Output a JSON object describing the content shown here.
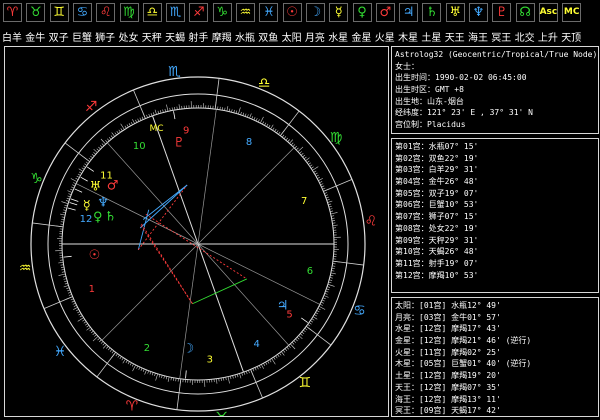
{
  "toolbar": {
    "buttons": [
      {
        "label": "白羊",
        "glyph": "♈",
        "color": "#ff3b3b",
        "icon": "aries-icon"
      },
      {
        "label": "金牛",
        "glyph": "♉",
        "color": "#33dd33",
        "icon": "taurus-icon"
      },
      {
        "label": "双子",
        "glyph": "♊",
        "color": "#ffff33",
        "icon": "gemini-icon"
      },
      {
        "label": "巨蟹",
        "glyph": "♋",
        "color": "#44aaff",
        "icon": "cancer-icon"
      },
      {
        "label": "狮子",
        "glyph": "♌",
        "color": "#ff3b3b",
        "icon": "leo-icon"
      },
      {
        "label": "处女",
        "glyph": "♍",
        "color": "#33dd33",
        "icon": "virgo-icon"
      },
      {
        "label": "天秤",
        "glyph": "♎",
        "color": "#ffff33",
        "icon": "libra-icon"
      },
      {
        "label": "天蝎",
        "glyph": "♏",
        "color": "#44aaff",
        "icon": "scorpio-icon"
      },
      {
        "label": "射手",
        "glyph": "♐",
        "color": "#ff3b3b",
        "icon": "sagittarius-icon"
      },
      {
        "label": "摩羯",
        "glyph": "♑",
        "color": "#33dd33",
        "icon": "capricorn-icon"
      },
      {
        "label": "水瓶",
        "glyph": "♒",
        "color": "#ffff33",
        "icon": "aquarius-icon"
      },
      {
        "label": "双鱼",
        "glyph": "♓",
        "color": "#44aaff",
        "icon": "pisces-icon"
      },
      {
        "label": "太阳",
        "glyph": "☉",
        "color": "#ff3b3b",
        "icon": "sun-icon"
      },
      {
        "label": "月亮",
        "glyph": "☽",
        "color": "#44aaff",
        "icon": "moon-icon"
      },
      {
        "label": "水星",
        "glyph": "☿",
        "color": "#ffff33",
        "icon": "mercury-icon"
      },
      {
        "label": "金星",
        "glyph": "♀",
        "color": "#33dd33",
        "icon": "venus-icon"
      },
      {
        "label": "火星",
        "glyph": "♂",
        "color": "#ff3b3b",
        "icon": "mars-icon"
      },
      {
        "label": "木星",
        "glyph": "♃",
        "color": "#44aaff",
        "icon": "jupiter-icon"
      },
      {
        "label": "土星",
        "glyph": "♄",
        "color": "#33dd33",
        "icon": "saturn-icon"
      },
      {
        "label": "天王",
        "glyph": "♅",
        "color": "#ffff33",
        "icon": "uranus-icon"
      },
      {
        "label": "海王",
        "glyph": "♆",
        "color": "#44aaff",
        "icon": "neptune-icon"
      },
      {
        "label": "冥王",
        "glyph": "♇",
        "color": "#ff3b3b",
        "icon": "pluto-icon"
      },
      {
        "label": "北交",
        "glyph": "☊",
        "color": "#33dd33",
        "icon": "north-node-icon"
      },
      {
        "label": "上升",
        "glyph": "Asc",
        "color": "#ffff33",
        "icon": "ascendant-icon"
      },
      {
        "label": "天顶",
        "glyph": "MC",
        "color": "#ffff33",
        "icon": "midheaven-icon"
      }
    ]
  },
  "chart": {
    "house_numbers": [
      "1",
      "2",
      "3",
      "4",
      "5",
      "6",
      "7",
      "8",
      "9",
      "10",
      "11",
      "12"
    ],
    "signs": [
      {
        "glyph": "♈",
        "icon": "aries-icon",
        "color": "#ff3b3b"
      },
      {
        "glyph": "♉",
        "icon": "taurus-icon",
        "color": "#33dd33"
      },
      {
        "glyph": "♊",
        "icon": "gemini-icon",
        "color": "#ffff33"
      },
      {
        "glyph": "♋",
        "icon": "cancer-icon",
        "color": "#44aaff"
      },
      {
        "glyph": "♌",
        "icon": "leo-icon",
        "color": "#ff3b3b"
      },
      {
        "glyph": "♍",
        "icon": "virgo-icon",
        "color": "#33dd33"
      },
      {
        "glyph": "♎",
        "icon": "libra-icon",
        "color": "#ffff33"
      },
      {
        "glyph": "♏",
        "icon": "scorpio-icon",
        "color": "#44aaff"
      },
      {
        "glyph": "♐",
        "icon": "sagittarius-icon",
        "color": "#ff3b3b"
      },
      {
        "glyph": "♑",
        "icon": "capricorn-icon",
        "color": "#33dd33"
      },
      {
        "glyph": "♒",
        "icon": "aquarius-icon",
        "color": "#ffff33"
      },
      {
        "glyph": "♓",
        "icon": "pisces-icon",
        "color": "#44aaff"
      }
    ],
    "asc_label": "Asc",
    "mc_label": "MC"
  },
  "info": {
    "header": [
      "Astrolog32 (Geocentric/Tropical/True Node)",
      "女士：",
      "出生时间：1990-02-02 06:45:00",
      "出生时区：GMT +8",
      "出生地：山东-烟台",
      "经纬度：121° 23' E , 37° 31' N",
      "宫位制：Placidus"
    ],
    "houses": [
      "第01宫：水瓶07° 15'",
      "第02宫：双鱼22° 19'",
      "第03宫：白羊29° 31'",
      "第04宫：金牛26° 48'",
      "第05宫：双子19° 07'",
      "第06宫：巨蟹10° 53'",
      "第07宫：狮子07° 15'",
      "第08宫：处女22° 19'",
      "第09宫：天秤29° 31'",
      "第10宫：天蝎26° 48'",
      "第11宫：射手19° 07'",
      "第12宫：摩羯10° 53'"
    ],
    "planets": [
      "太阳：[01宫] 水瓶12° 49'",
      "月亮：[03宫] 金牛01° 57'",
      "水星：[12宫] 摩羯17° 43'",
      "金星：[12宫] 摩羯21° 46'  (逆行)",
      "火星：[11宫] 摩羯02° 25'",
      "木星：[05宫] 巨蟹01° 40'  (逆行)",
      "土星：[12宫] 摩羯19° 20'",
      "天王：[12宫] 摩羯07° 35'",
      "海王：[12宫] 摩羯13° 11'",
      "冥王：[09宫] 天蝎17° 42'"
    ]
  }
}
